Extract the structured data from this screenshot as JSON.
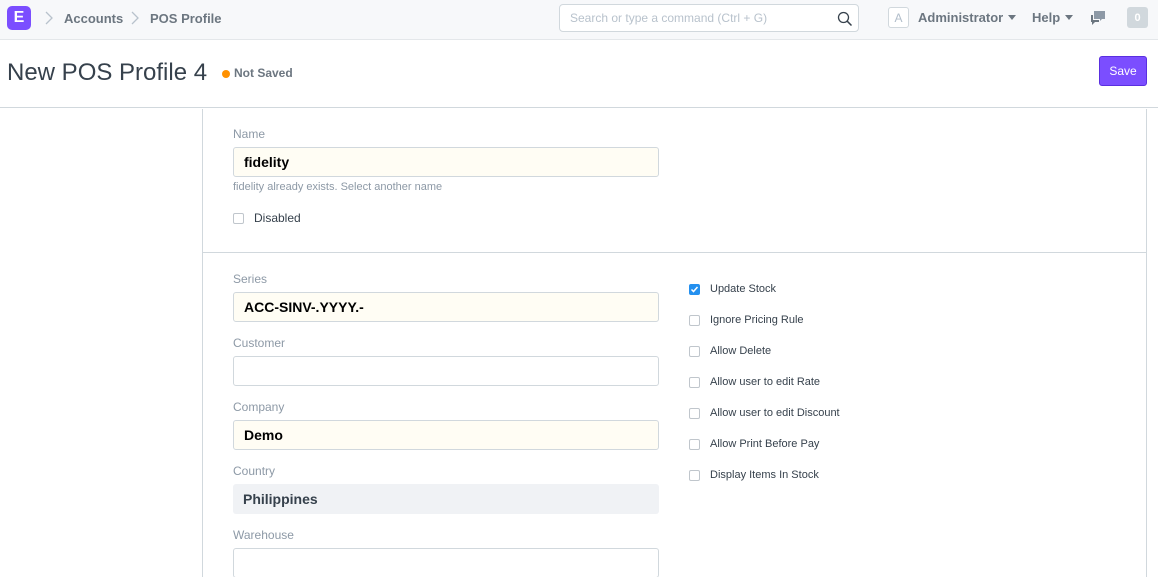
{
  "navbar": {
    "logo": "E",
    "breadcrumbs": [
      "Accounts",
      "POS Profile"
    ],
    "search_placeholder": "Search or type a command (Ctrl + G)",
    "avatar": "A",
    "user": "Administrator",
    "help": "Help",
    "notifications": "0"
  },
  "page": {
    "title": "New POS Profile 4",
    "status": "Not Saved",
    "save_label": "Save"
  },
  "form": {
    "name_label": "Name",
    "name_value": "fidelity",
    "name_help": "fidelity already exists. Select another name",
    "disabled_label": "Disabled",
    "series_label": "Series",
    "series_value": "ACC-SINV-.YYYY.-",
    "customer_label": "Customer",
    "customer_value": "",
    "company_label": "Company",
    "company_value": "Demo",
    "country_label": "Country",
    "country_value": "Philippines",
    "warehouse_label": "Warehouse",
    "warehouse_value": "",
    "checkboxes": [
      {
        "label": "Update Stock",
        "checked": true
      },
      {
        "label": "Ignore Pricing Rule",
        "checked": false
      },
      {
        "label": "Allow Delete",
        "checked": false
      },
      {
        "label": "Allow user to edit Rate",
        "checked": false
      },
      {
        "label": "Allow user to edit Discount",
        "checked": false
      },
      {
        "label": "Allow Print Before Pay",
        "checked": false
      },
      {
        "label": "Display Items In Stock",
        "checked": false
      }
    ]
  },
  "colors": {
    "primary": "#7b4eff",
    "status_dot": "#ff9100",
    "checkbox_checked": "#2490ef"
  }
}
